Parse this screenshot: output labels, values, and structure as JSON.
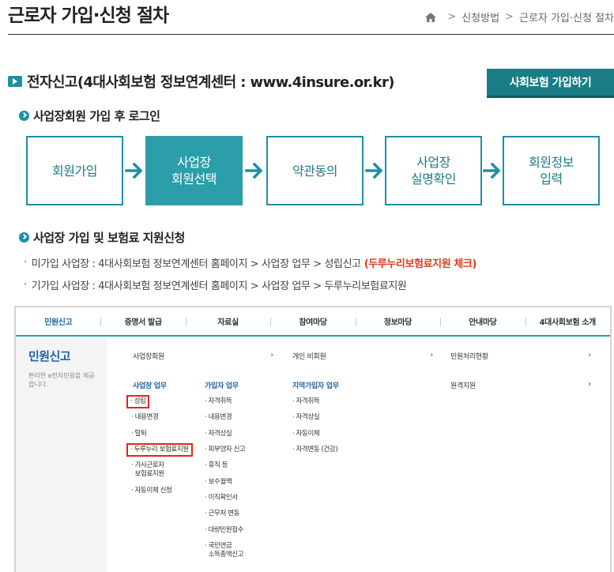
{
  "header": {
    "title": "근로자 가입·신청 절차",
    "breadcrumb": [
      "신청방법",
      "근로자 가입·신청 절차"
    ]
  },
  "section": {
    "title": "전자신고(4대사회보험 정보연계센터 : www.4insure.or.kr)",
    "join_button": "사회보험 가입하기"
  },
  "step_section": {
    "title": "사업장회원 가입 후 로그인"
  },
  "steps": [
    {
      "line1": "회원가입",
      "line2": ""
    },
    {
      "line1": "사업장",
      "line2": "회원선택"
    },
    {
      "line1": "약관동의",
      "line2": ""
    },
    {
      "line1": "사업장",
      "line2": "실명확인"
    },
    {
      "line1": "회원정보",
      "line2": "입력"
    }
  ],
  "apply_section": {
    "title": "사업장 가입 및 보험료 지원신청",
    "lines": [
      {
        "text": "미가입 사업장 : 4대사회보험 정보연계센터 홈페이지 > 사업장 업무 > 성립신고",
        "highlight": "(두루누리보험료지원 체크)"
      },
      {
        "text": "기가입 사업장 : 4대사회보험 정보연계센터 홈페이지 > 사업장 업무 > 두루누리보험료지원",
        "highlight": ""
      }
    ]
  },
  "screenshot": {
    "nav": [
      "민원신고",
      "증명서 발급",
      "자료실",
      "참여마당",
      "정보마당",
      "안내마당",
      "4대사회보험 소개"
    ],
    "left_title": "민원신고",
    "left_desc": "편리한 e전자민원을 제공합니다.",
    "menu_row": {
      "biz_member": "사업장회원",
      "personal_member": "개인 비회원",
      "status": "민원처리현황",
      "remote": "원격지원"
    },
    "col1": {
      "head": "사업장 업무",
      "items": [
        "· 성립",
        "· 내용변경",
        "· 탈퇴",
        "· 두루누리 보험료지원",
        "· 가사근로자\n  보험료지원",
        "· 자동이체 신청"
      ]
    },
    "col2": {
      "head": "가입자 업무",
      "items": [
        "· 자격취득",
        "· 내용변경",
        "· 자격상실",
        "· 피부양자 신고",
        "· 휴직 등",
        "· 보수월액",
        "· 이직확인서",
        "· 근무처 변동",
        "· 대량민원접수",
        "· 국민연금\n  소득총액신고"
      ]
    },
    "col3": {
      "head": "지역가입자 업무",
      "items": [
        "· 자격취득",
        "· 자격상실",
        "· 자동이체",
        "· 자격변동 (건강)"
      ]
    }
  },
  "colors": {
    "accent": "#1e8fa6",
    "accent_dark": "#1a7d86",
    "highlight_red": "#e03a1e",
    "link_blue": "#2260a8"
  }
}
